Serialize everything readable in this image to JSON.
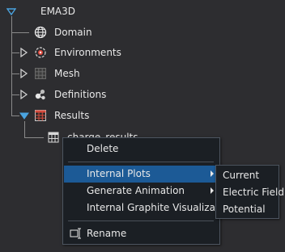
{
  "tree": {
    "root": "EMA3D",
    "items": [
      {
        "label": "Domain"
      },
      {
        "label": "Environments"
      },
      {
        "label": "Mesh"
      },
      {
        "label": "Definitions"
      },
      {
        "label": "Results"
      }
    ],
    "child": "charge_results"
  },
  "context_menu": {
    "items": [
      "Delete",
      "Internal Plots",
      "Generate Animation",
      "Internal Graphite Visualization",
      "Rename"
    ]
  },
  "submenu": {
    "items": [
      "Current",
      "Electric Field",
      "Potential"
    ]
  },
  "colors": {
    "highlight": "#1c5a96",
    "expander": "#4aa3df",
    "menu_bg": "#1b1f24"
  }
}
